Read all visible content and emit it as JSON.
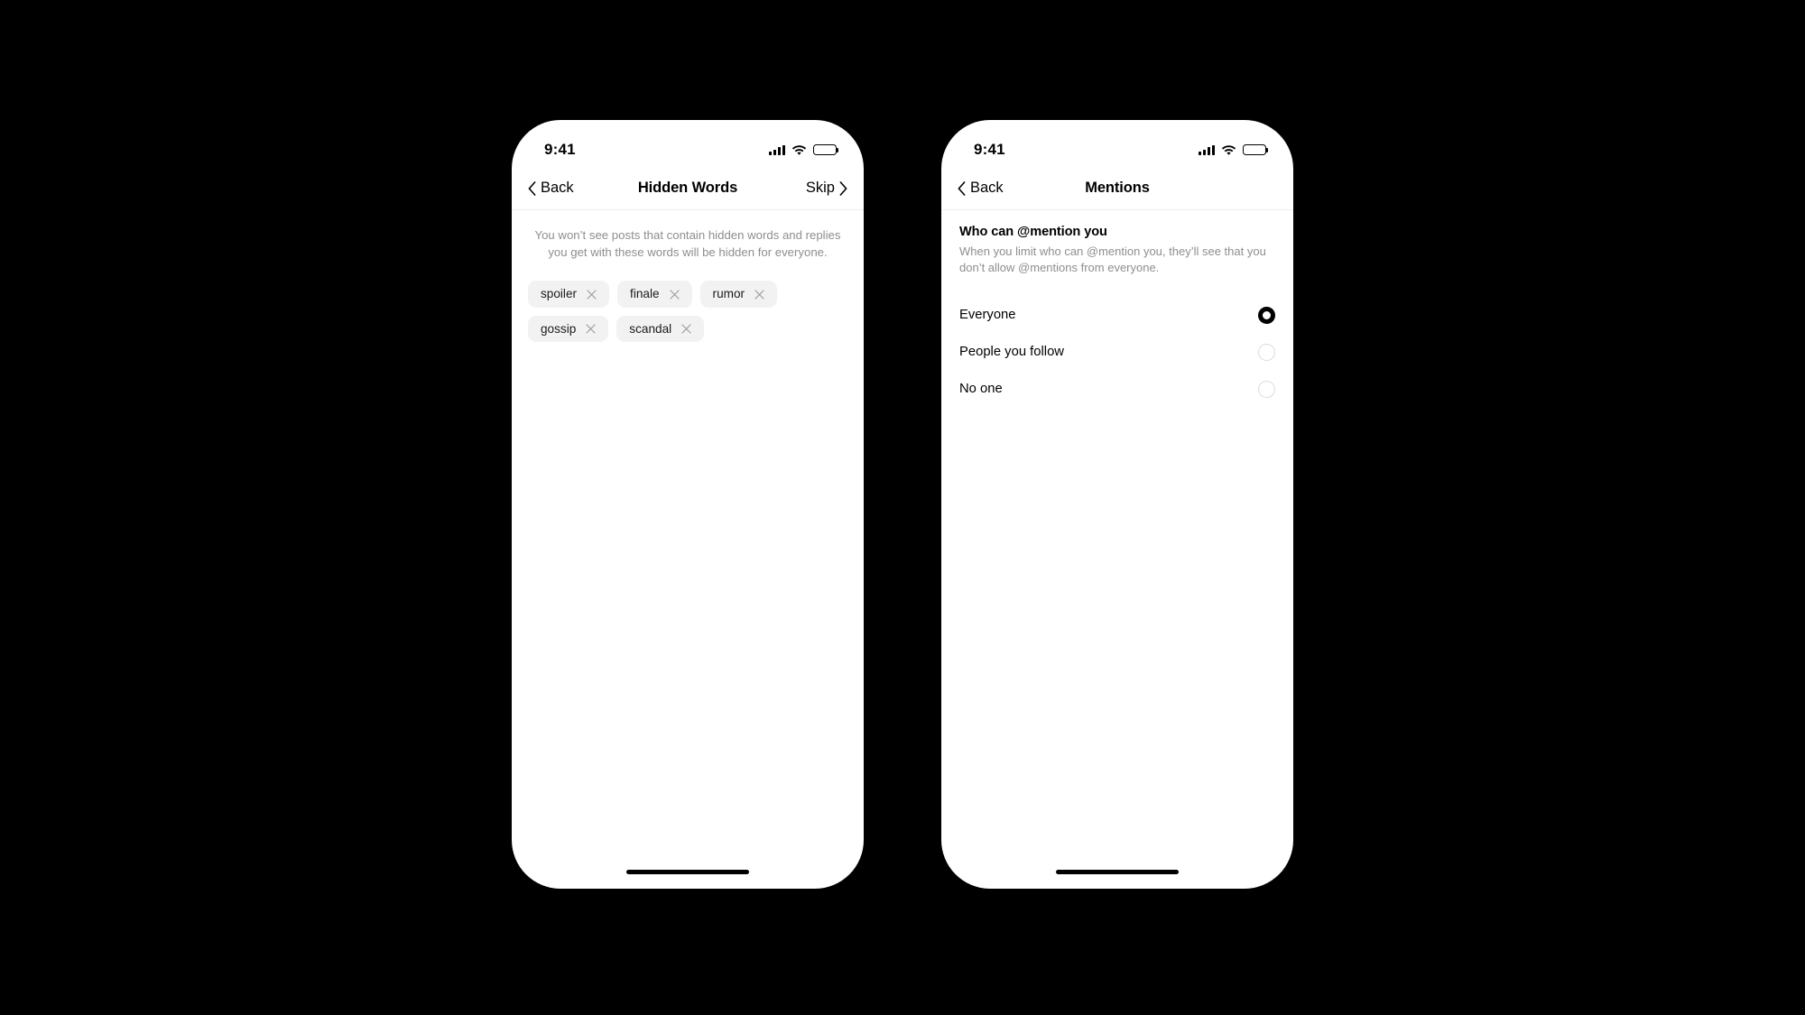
{
  "background_color": "#000000",
  "phones": [
    {
      "id": "hidden-words",
      "status_bar": {
        "time": "9:41",
        "icons": [
          "cellular-signal-icon",
          "wifi-icon",
          "battery-icon"
        ]
      },
      "nav": {
        "back_label": "Back",
        "title": "Hidden Words",
        "right_label": "Skip"
      },
      "description": "You won’t see posts that contain hidden words and replies you get with these words will be hidden for everyone.",
      "chips": [
        {
          "word": "spoiler",
          "remove_icon": "close-icon"
        },
        {
          "word": "finale",
          "remove_icon": "close-icon"
        },
        {
          "word": "rumor",
          "remove_icon": "close-icon"
        },
        {
          "word": "gossip",
          "remove_icon": "close-icon"
        },
        {
          "word": "scandal",
          "remove_icon": "close-icon"
        }
      ]
    },
    {
      "id": "mentions",
      "status_bar": {
        "time": "9:41",
        "icons": [
          "cellular-signal-icon",
          "wifi-icon",
          "battery-icon"
        ]
      },
      "nav": {
        "back_label": "Back",
        "title": "Mentions",
        "right_label": ""
      },
      "section": {
        "title": "Who can @mention you",
        "subtitle": "When you limit who can @mention you, they’ll see that you don’t allow @mentions from everyone."
      },
      "options": [
        {
          "label": "Everyone",
          "selected": true
        },
        {
          "label": "People you follow",
          "selected": false
        },
        {
          "label": "No one",
          "selected": false
        }
      ]
    }
  ],
  "colors": {
    "text_primary": "#000000",
    "text_secondary": "#8e8e8e",
    "chip_background": "#f2f2f2",
    "radio_unselected_border": "#dcdcdc",
    "radio_selected": "#000000",
    "divider": "#efefef"
  }
}
